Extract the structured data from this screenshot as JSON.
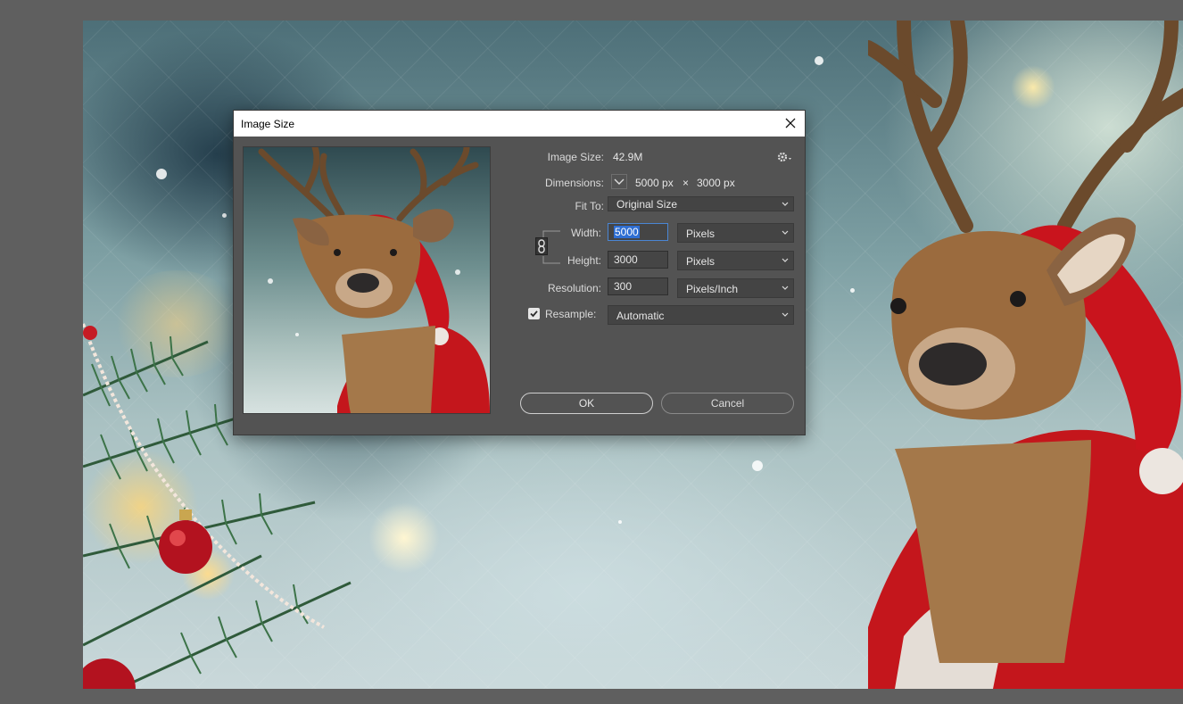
{
  "dialog": {
    "title": "Image Size",
    "image_size_label": "Image Size:",
    "image_size_value": "42.9M",
    "dimensions_label": "Dimensions:",
    "dimensions_width": "5000 px",
    "dimensions_times": "×",
    "dimensions_height": "3000 px",
    "fit_to_label": "Fit To:",
    "fit_to_value": "Original Size",
    "width_label": "Width:",
    "width_value": "5000",
    "width_unit": "Pixels",
    "height_label": "Height:",
    "height_value": "3000",
    "height_unit": "Pixels",
    "resolution_label": "Resolution:",
    "resolution_value": "300",
    "resolution_unit": "Pixels/Inch",
    "resample_label": "Resample:",
    "resample_checked": true,
    "resample_value": "Automatic",
    "ok_label": "OK",
    "cancel_label": "Cancel"
  },
  "icons": {
    "close": "close-icon",
    "settings": "gear-icon",
    "link": "link-icon",
    "dimensions_dropdown": "chevron-down-icon"
  },
  "colors": {
    "dialog_bg": "#535353",
    "workspace_bg": "#5f5f5f",
    "focus_accent": "#4a86d4",
    "text_selection": "#2f6fd3"
  }
}
